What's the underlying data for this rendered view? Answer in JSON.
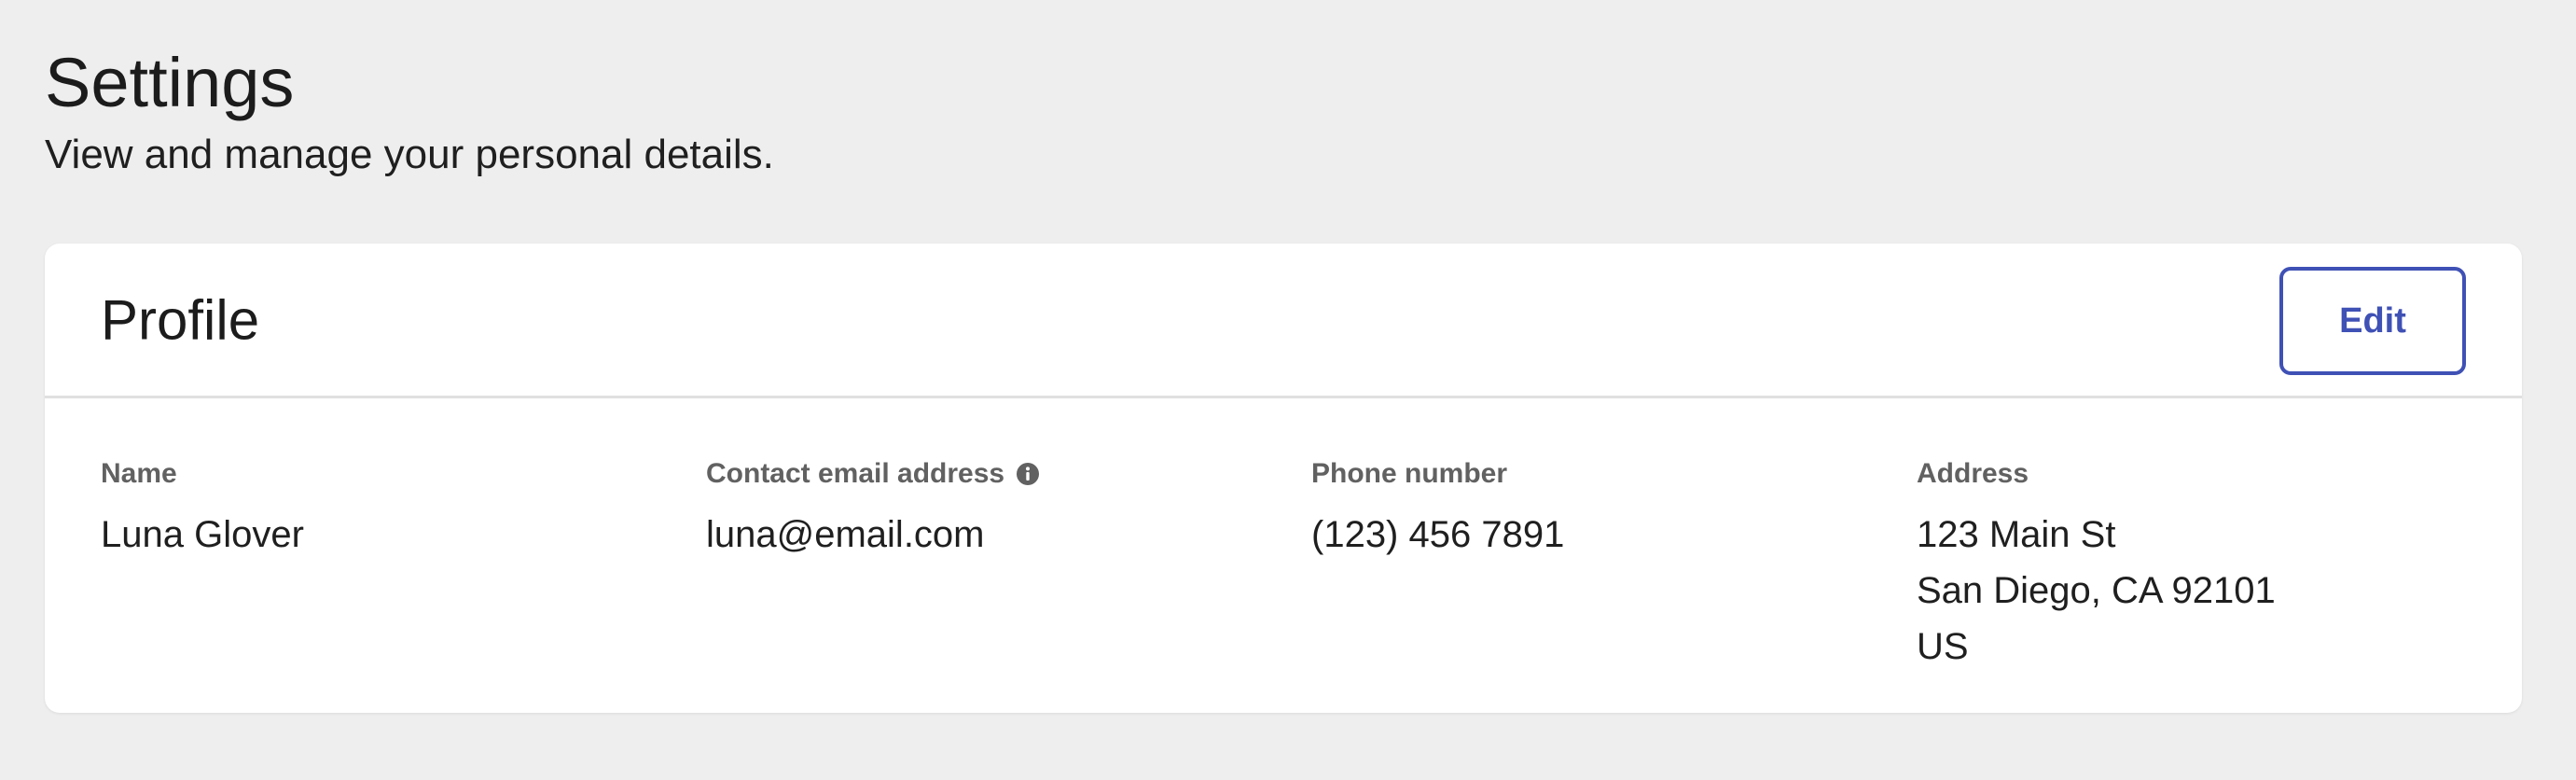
{
  "page": {
    "title": "Settings",
    "subtitle": "View and manage your personal details."
  },
  "profile_card": {
    "title": "Profile",
    "edit_label": "Edit"
  },
  "fields": {
    "name": {
      "label": "Name",
      "value": "Luna Glover"
    },
    "email": {
      "label": "Contact email address",
      "value": "luna@email.com",
      "icon": "info-icon"
    },
    "phone": {
      "label": "Phone number",
      "value": "(123) 456 7891"
    },
    "address": {
      "label": "Address",
      "line1": "123 Main St",
      "line2": "San Diego, CA 92101",
      "line3": "US"
    }
  },
  "colors": {
    "background": "#eeeeee",
    "card": "#ffffff",
    "accent": "#3f51b5",
    "label": "#616161",
    "text": "#1f1f1f"
  }
}
